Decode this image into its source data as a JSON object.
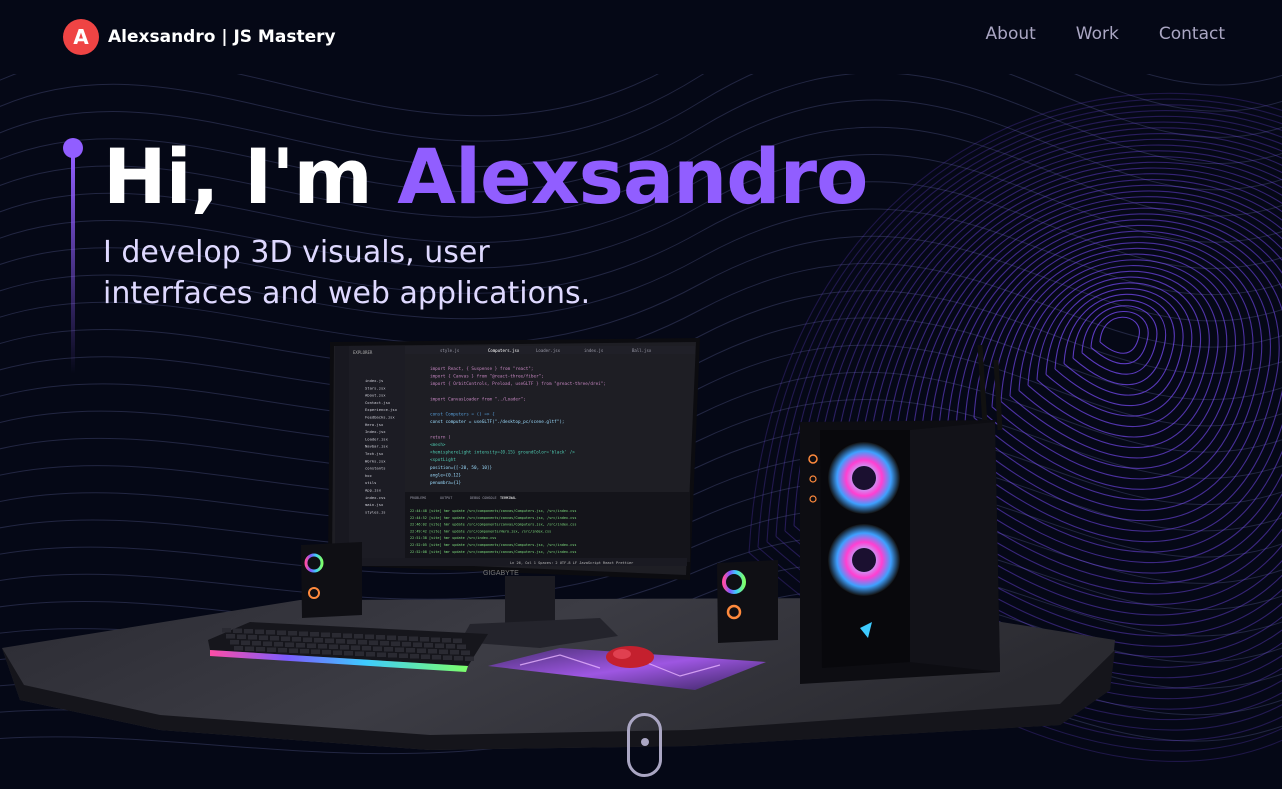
{
  "navbar": {
    "logo_letter": "A",
    "brand": "Alexsandro  | JS Mastery",
    "links": [
      "About",
      "Work",
      "Contact"
    ]
  },
  "hero": {
    "greeting": "Hi, I'm ",
    "name": "Alexsandro",
    "subtitle_line1": "I develop 3D visuals, user",
    "subtitle_line2": "interfaces and web applications."
  },
  "monitor": {
    "brand": "GIGABYTE",
    "tabs": [
      "style.js",
      "Computers.jsx",
      "Loader.jsx",
      "index.js",
      "Ball.jsx"
    ],
    "explorer_title": "EXPLORER",
    "files": [
      "index.js",
      "Stars.jsx",
      "About.jsx",
      "Contact.jsx",
      "Experience.jsx",
      "Feedbacks.jsx",
      "Hero.jsx",
      "Index.jsx",
      "Loader.jsx",
      "Navbar.jsx",
      "Tech.jsx",
      "Works.jsx",
      "constants",
      "hoc",
      "utils",
      "App.jsx",
      "index.css",
      "main.jsx",
      "styles.js"
    ],
    "code_lines": [
      "import React, { Suspense } from \"react\";",
      "import { Canvas } from \"@react-three/fiber\";",
      "import { OrbitControls, Preload, useGLTF } from \"@react-three/drei\";",
      "",
      "import CanvasLoader from \"../Loader\";",
      "",
      "const Computers = () => {",
      "  const computer = useGLTF(\"./desktop_pc/scene.gltf\");",
      "",
      "  return (",
      "    <mesh>",
      "      <hemisphereLight intensity={0.15} groundColor='black' />",
      "      <spotLight",
      "        position={[-20, 50, 10]}",
      "        angle={0.12}",
      "        penumbra={1}"
    ],
    "panel_tabs": [
      "PROBLEMS",
      "OUTPUT",
      "DEBUG CONSOLE",
      "TERMINAL"
    ],
    "terminal_lines": [
      "22:44:48 [vite] hmr update /src/components/canvas/Computers.jsx, /src/index.css",
      "22:44:52 [vite] hmr update /src/components/canvas/Computers.jsx, /src/index.css",
      "22:46:02 [vite] hmr update /src/components/canvas/Computers.jsx, /src/index.css",
      "22:49:42 [vite] hmr update /src/components/Hero.jsx, /src/index.css",
      "22:51:38 [vite] hmr update /src/index.css",
      "22:52:05 [vite] hmr update /src/components/canvas/Computers.jsx, /src/index.css",
      "22:52:08 [vite] hmr update /src/components/canvas/Computers.jsx, /src/index.css"
    ],
    "status_bar": "Ln 26, Col 1   Spaces: 2   UTF-8   LF   JavaScript React   Prettier"
  },
  "colors": {
    "background": "#050816",
    "accent": "#915eff",
    "secondary_text": "#aaa6c3",
    "logo_red": "#ef4444"
  },
  "icons": [
    "logo-badge",
    "scroll-mouse-icon"
  ]
}
